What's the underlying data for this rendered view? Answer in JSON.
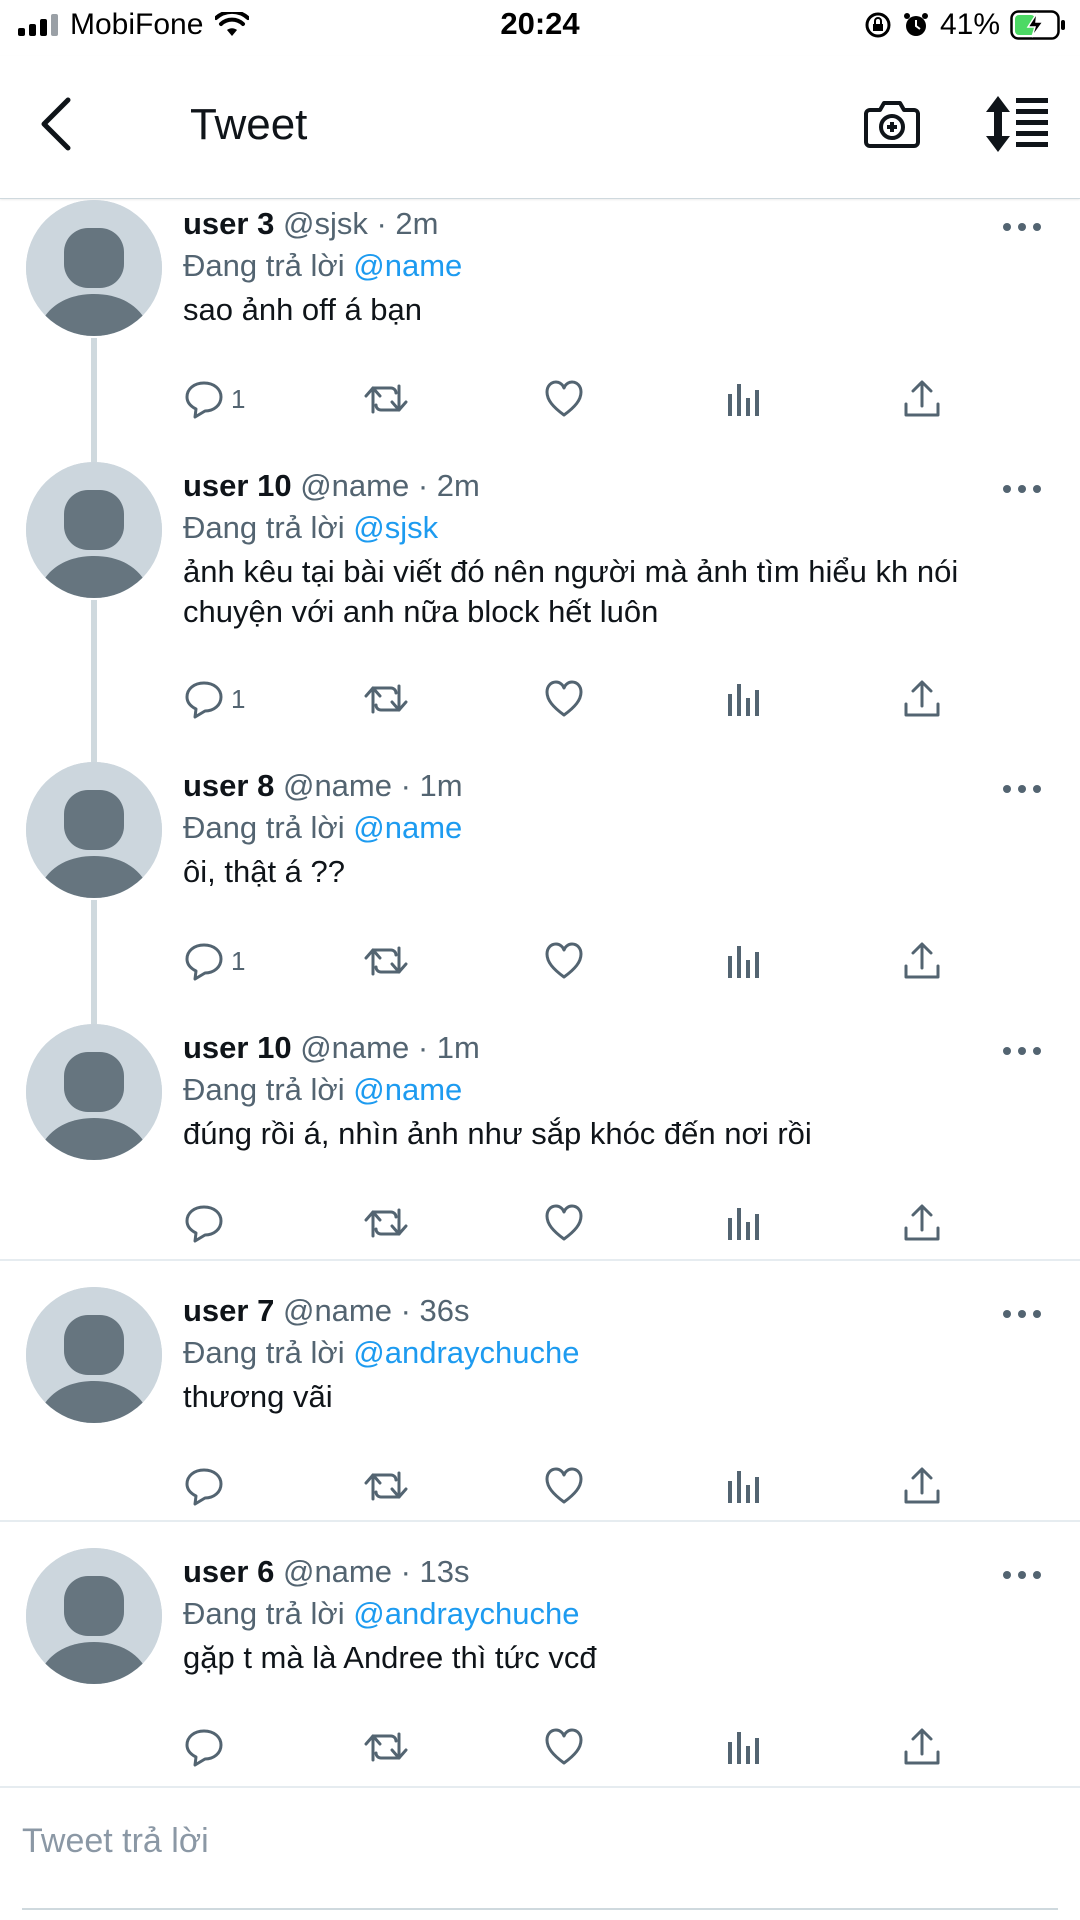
{
  "status_bar": {
    "carrier": "MobiFone",
    "time": "20:24",
    "battery": "41%",
    "icons": [
      "signal-icon",
      "wifi-icon",
      "orientation-lock-icon",
      "alarm-icon",
      "battery-charging-icon"
    ]
  },
  "header": {
    "title": "Tweet",
    "icons": [
      "back-arrow-icon",
      "camera-plus-icon",
      "sort-icon"
    ]
  },
  "colors": {
    "mention": "#1d9bf0",
    "meta": "#536471",
    "avatar_bg": "#ccd6dd",
    "avatar_fg": "#66757f"
  },
  "tweets": [
    {
      "name": "user 3",
      "handle": "@sjsk",
      "time": "· 2m",
      "reply_prefix": "Đang trả lời",
      "reply_to": "@name",
      "text": "sao ảnh off á bạn",
      "reply_count": "1"
    },
    {
      "name": "user 10",
      "handle": "@name",
      "time": "· 2m",
      "reply_prefix": "Đang trả lời",
      "reply_to": "@sjsk",
      "text": "ảnh kêu tại bài viết đó nên người mà ảnh tìm hiểu kh nói chuyện với anh nữa block hết luôn",
      "reply_count": "1"
    },
    {
      "name": "user 8",
      "handle": "@name",
      "time": "· 1m",
      "reply_prefix": "Đang trả lời",
      "reply_to": "@name",
      "text": "ôi, thật á ??",
      "reply_count": "1"
    },
    {
      "name": "user 10",
      "handle": "@name",
      "time": "· 1m",
      "reply_prefix": "Đang trả lời",
      "reply_to": "@name",
      "text": "đúng rồi á, nhìn ảnh như sắp khóc đến nơi rồi",
      "reply_count": ""
    },
    {
      "name": "user 7",
      "handle": "@name",
      "time": "· 36s",
      "reply_prefix": "Đang trả lời",
      "reply_to": "@andraychuche",
      "text": "thương vãi",
      "reply_count": ""
    },
    {
      "name": "user 6",
      "handle": "@name",
      "time": "· 13s",
      "reply_prefix": "Đang trả lời",
      "reply_to": "@andraychuche",
      "text": "gặp t mà là Andree thì tức vcđ",
      "reply_count": ""
    }
  ],
  "action_icons": [
    "reply-icon",
    "retweet-icon",
    "like-icon",
    "analytics-icon",
    "share-icon"
  ],
  "composer": {
    "placeholder": "Tweet trả lời"
  }
}
